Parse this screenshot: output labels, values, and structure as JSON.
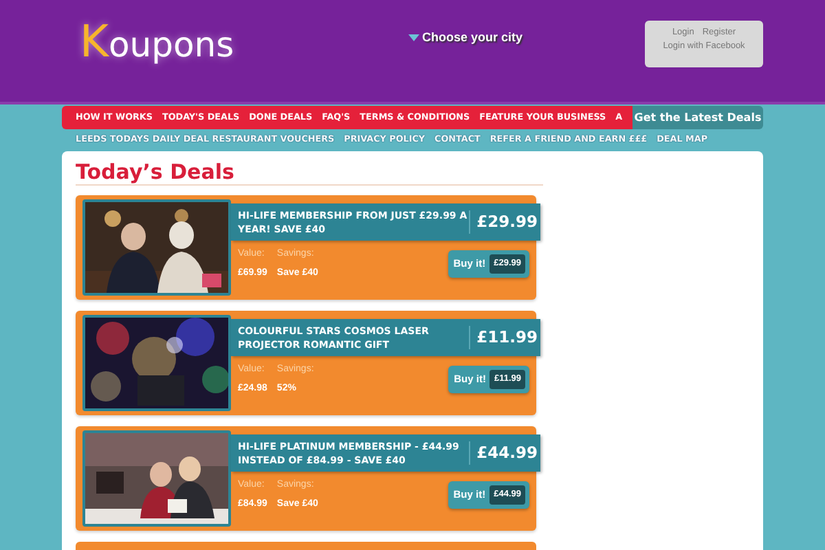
{
  "header": {
    "logo": "Koupons",
    "city_selector": "Choose your city",
    "account": {
      "links": [
        "Login",
        "Register"
      ],
      "facebook": "Login with Facebook"
    }
  },
  "nav": {
    "primary": [
      "HOW IT WORKS",
      "TODAY'S DEALS",
      "DONE DEALS",
      "FAQ'S",
      "TERMS & CONDITIONS",
      "FEATURE YOUR BUSINESS",
      "A"
    ],
    "tab": "Get the Latest Deals",
    "secondary": [
      "LEEDS TODAYS DAILY DEAL RESTAURANT VOUCHERS",
      "PRIVACY POLICY",
      "CONTACT",
      "REFER A FRIEND AND EARN £££",
      "DEAL MAP"
    ]
  },
  "content": {
    "heading": "Today’s Deals",
    "deals": [
      {
        "kind": "picture",
        "title": "HI-LIFE MEMBERSHIP FROM JUST £29.99 A YEAR! SAVE £40",
        "price": "£29.99",
        "value_label": "Value:",
        "value": "£69.99",
        "savings_label": "Savings:",
        "savings": "Save £40",
        "buy": "Buy it!",
        "buy_price": "£29.99"
      },
      {
        "kind": "picture",
        "title": "COLOURFUL STARS COSMOS LASER PROJECTOR ROMANTIC GIFT",
        "price": "£11.99",
        "value_label": "Value:",
        "value": "£24.98",
        "savings_label": "Savings:",
        "savings": "52%",
        "buy": "Buy it!",
        "buy_price": "£11.99"
      },
      {
        "kind": "picture",
        "title": "HI-LIFE PLATINUM MEMBERSHIP - £44.99 INSTEAD OF £84.99 - SAVE £40",
        "price": "£44.99",
        "value_label": "Value:",
        "value": "£84.99",
        "savings_label": "Savings:",
        "savings": "Save £40",
        "buy": "Buy it!",
        "buy_price": "£44.99"
      }
    ]
  }
}
